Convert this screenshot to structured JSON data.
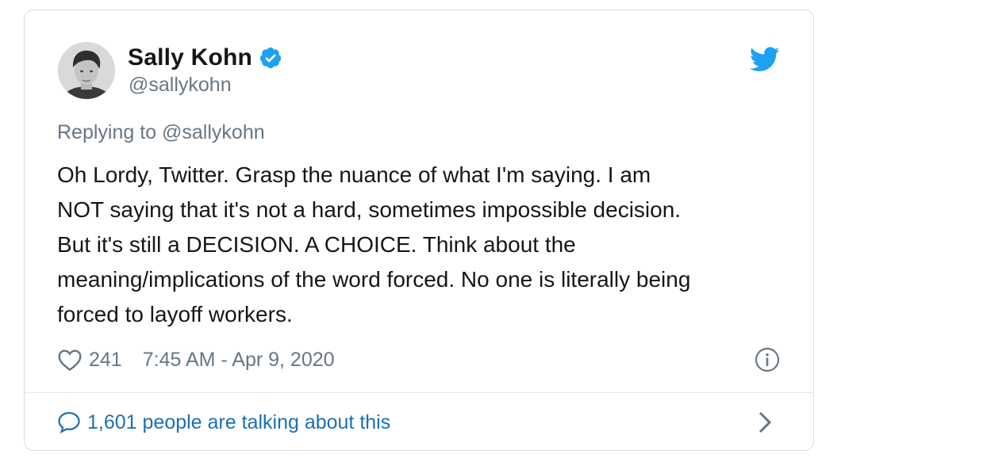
{
  "tweet": {
    "author": {
      "display_name": "Sally Kohn",
      "handle": "@sallykohn",
      "verified": true
    },
    "replying_to": "Replying to @sallykohn",
    "text": "Oh Lordy, Twitter.  Grasp the nuance of what I'm saying.  I am\nNOT saying that it's not a hard, sometimes impossible decision.\nBut it's still a DECISION.  A CHOICE.  Think about the\nmeaning/implications of the word forced. No one is literally being\nforced to layoff workers.",
    "likes": "241",
    "timestamp": "7:45 AM - Apr 9, 2020",
    "talking": "1,601 people are talking about this"
  },
  "icons": {
    "verified": "verified-badge-icon",
    "bird": "twitter-bird-icon",
    "heart": "heart-icon",
    "info": "info-icon",
    "bubble": "speech-bubble-icon",
    "chevron": "chevron-right-icon"
  },
  "colors": {
    "twitter_blue": "#1da1f2",
    "link_blue": "#1b6fb4",
    "secondary_text": "#657786",
    "primary_text": "#14171a",
    "border": "#d8dde2"
  }
}
